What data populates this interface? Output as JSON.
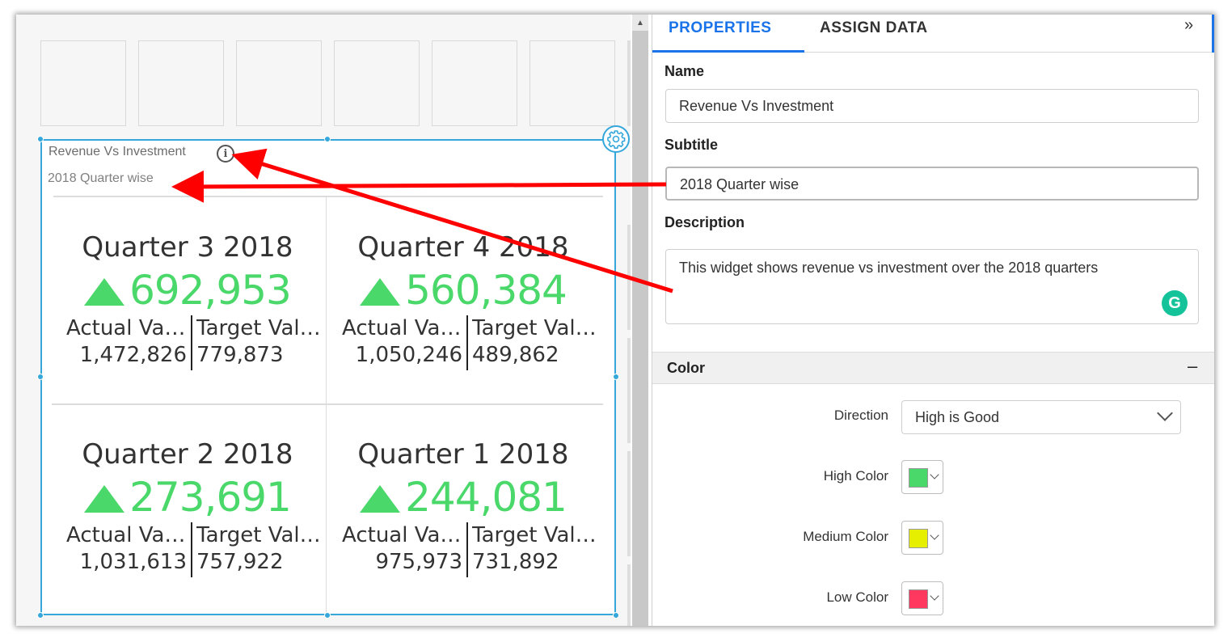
{
  "widget": {
    "title": "Revenue Vs Investment",
    "subtitle": "2018 Quarter wise",
    "kpis": [
      {
        "name": "Quarter 3 2018",
        "value": "692,953",
        "actual_label": "Actual Val…",
        "actual_value": "1,472,826",
        "target_label": "Target Val…",
        "target_value": "779,873",
        "trend": "up"
      },
      {
        "name": "Quarter 4 2018",
        "value": "560,384",
        "actual_label": "Actual Val…",
        "actual_value": "1,050,246",
        "target_label": "Target Val…",
        "target_value": "489,862",
        "trend": "up"
      },
      {
        "name": "Quarter 2 2018",
        "value": "273,691",
        "actual_label": "Actual Val…",
        "actual_value": "1,031,613",
        "target_label": "Target Val…",
        "target_value": "757,922",
        "trend": "up"
      },
      {
        "name": "Quarter 1 2018",
        "value": "244,081",
        "actual_label": "Actual Val…",
        "actual_value": "975,973",
        "target_label": "Target Val…",
        "target_value": "731,892",
        "trend": "up"
      }
    ],
    "info_glyph": "i"
  },
  "panel": {
    "tabs": [
      {
        "label": "PROPERTIES"
      },
      {
        "label": "ASSIGN DATA"
      }
    ],
    "collapse_glyph": "»",
    "name_label": "Name",
    "name_value": "Revenue Vs Investment",
    "subtitle_label": "Subtitle",
    "subtitle_value": "2018 Quarter wise",
    "description_label": "Description",
    "description_value": "This widget shows revenue vs investment over the 2018 quarters",
    "grammarly_glyph": "G",
    "color_section": {
      "title": "Color",
      "toggle": "–",
      "direction_label": "Direction",
      "direction_value": "High is Good",
      "high_label": "High Color",
      "medium_label": "Medium Color",
      "low_label": "Low Color"
    }
  },
  "colors": {
    "accent": "#1a73e8",
    "selection": "#35a7da",
    "kpi_good": "#4ad86a",
    "high": "#4ad86a",
    "medium": "#e6ef00",
    "low": "#ff3860",
    "annotation": "#ff0000"
  },
  "icons": {
    "gear": "gear-icon",
    "info": "info-icon",
    "trend": "triangle-up-icon",
    "chevron": "chevron-down-icon",
    "collapse": "double-chevron-right-icon",
    "grammarly": "grammarly-icon"
  }
}
